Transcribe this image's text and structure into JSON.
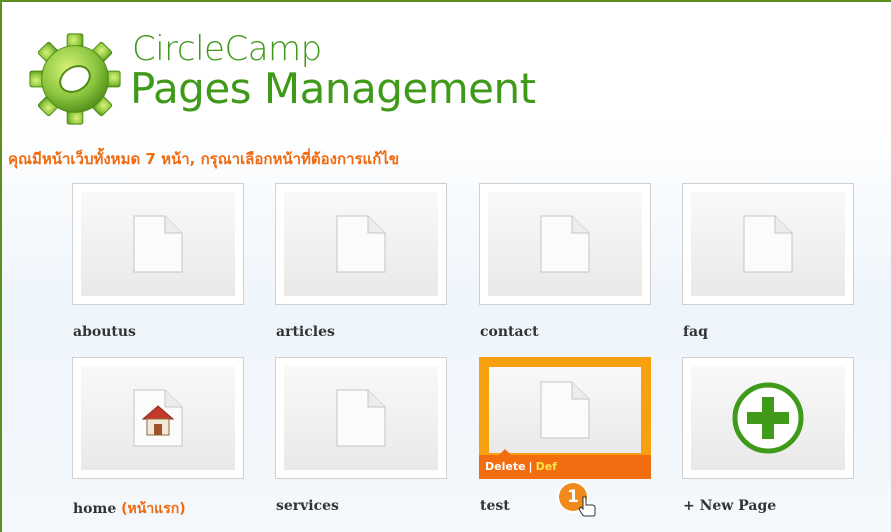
{
  "header": {
    "brand_line1": "CircleCamp",
    "brand_line2": "Pages Management",
    "logo_icon": "gear-logo-icon"
  },
  "instruction": "คุณมีหน้าเว็บทั้งหมด 7 หน้า, กรุณาเลือกหน้าที่ต้องการแก้ไข",
  "pages": [
    {
      "label": "aboutus",
      "icon": "page-icon"
    },
    {
      "label": "articles",
      "icon": "page-icon"
    },
    {
      "label": "contact",
      "icon": "page-icon"
    },
    {
      "label": "faq",
      "icon": "page-icon"
    },
    {
      "label": "home",
      "suffix": "(หน้าแรก)",
      "icon": "home-icon"
    },
    {
      "label": "services",
      "icon": "page-icon"
    },
    {
      "label": "test",
      "icon": "page-icon",
      "selected": true
    }
  ],
  "new_page": {
    "label": "+ New Page",
    "icon": "plus-circle-icon"
  },
  "actions": {
    "delete": "Delete",
    "separator": "|",
    "default": "Def"
  },
  "step_badge": "1",
  "colors": {
    "brand_green": "#3f9a1a",
    "instruction_orange": "#f06a0f",
    "selected_border": "#f7a111",
    "action_bar": "#f26d0f",
    "default_link": "#ffe34c",
    "frame_border": "#5b8f22"
  }
}
